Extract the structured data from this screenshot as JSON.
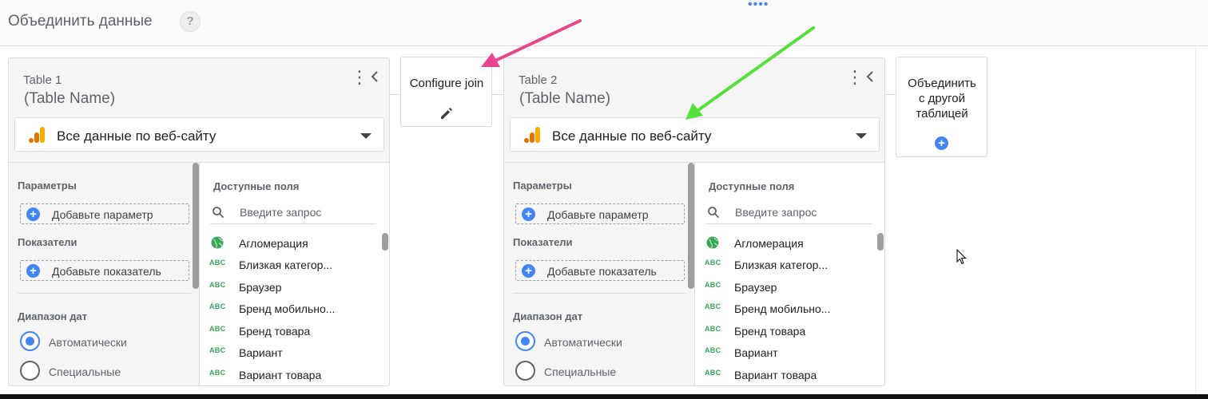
{
  "header": {
    "title": "Объединить данные",
    "help": "?",
    "drag_handle": "••••"
  },
  "colors": {
    "accent": "#4285f4",
    "pink_arrow": "#e8458e",
    "green_arrow": "#55e03c",
    "dimension_green": "#34a853",
    "analytics_orange": "#f9ab00"
  },
  "tables": [
    {
      "label": "Table 1",
      "name": "(Table Name)",
      "source": "Все данные по веб-сайту",
      "params_label": "Параметры",
      "add_param": "Добавьте параметр",
      "metrics_label": "Показатели",
      "add_metric": "Добавьте показатель",
      "date_range_label": "Диапазон дат",
      "date_options": [
        "Автоматически",
        "Специальные"
      ],
      "selected_date_option": "Автоматически",
      "fields_label": "Доступные поля",
      "search_placeholder": "Введите запрос",
      "fields": [
        {
          "icon": "globe-icon",
          "name": "Агломерация"
        },
        {
          "icon": "ABC",
          "name": "Близкая категор..."
        },
        {
          "icon": "ABC",
          "name": "Браузер"
        },
        {
          "icon": "ABC",
          "name": "Бренд мобильно..."
        },
        {
          "icon": "ABC",
          "name": "Бренд товара"
        },
        {
          "icon": "ABC",
          "name": "Вариант"
        },
        {
          "icon": "ABC",
          "name": "Вариант товара"
        }
      ]
    },
    {
      "label": "Table 2",
      "name": "(Table Name)",
      "source": "Все данные по веб-сайту",
      "params_label": "Параметры",
      "add_param": "Добавьте параметр",
      "metrics_label": "Показатели",
      "add_metric": "Добавьте показатель",
      "date_range_label": "Диапазон дат",
      "date_options": [
        "Автоматически",
        "Специальные"
      ],
      "selected_date_option": "Автоматически",
      "fields_label": "Доступные поля",
      "search_placeholder": "Введите запрос",
      "fields": [
        {
          "icon": "globe-icon",
          "name": "Агломерация"
        },
        {
          "icon": "ABC",
          "name": "Близкая категор..."
        },
        {
          "icon": "ABC",
          "name": "Браузер"
        },
        {
          "icon": "ABC",
          "name": "Бренд мобильно..."
        },
        {
          "icon": "ABC",
          "name": "Бренд товара"
        },
        {
          "icon": "ABC",
          "name": "Вариант"
        },
        {
          "icon": "ABC",
          "name": "Вариант товара"
        }
      ]
    }
  ],
  "configure_join": {
    "label": "Configure join",
    "icon": "pencil-icon"
  },
  "join_another": {
    "label_lines": [
      "Объединить",
      "с другой",
      "таблицей"
    ],
    "icon": "plus-icon"
  }
}
